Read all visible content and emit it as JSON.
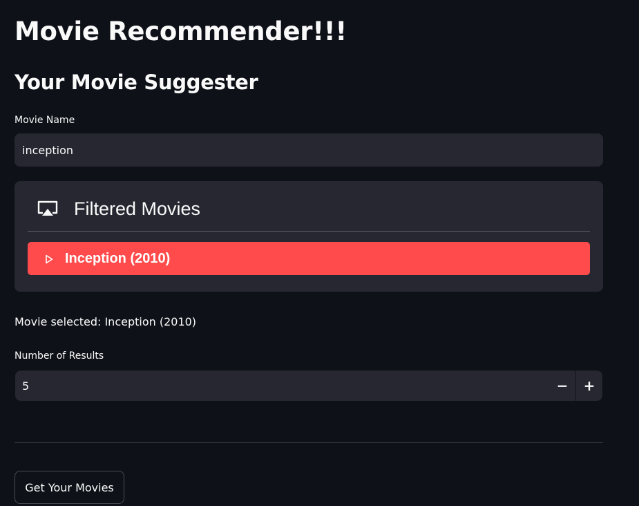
{
  "app": {
    "title": "Movie Recommender!!!",
    "subtitle": "Your Movie Suggester"
  },
  "movie_name": {
    "label": "Movie Name",
    "value": "inception"
  },
  "filtered": {
    "icon": "airplay-icon",
    "title": "Filtered Movies",
    "items": [
      {
        "label": "Inception (2010)",
        "icon": "play-triangle-icon"
      }
    ]
  },
  "selection": {
    "text": "Movie selected: Inception (2010)"
  },
  "results": {
    "label": "Number of Results",
    "value": "5",
    "minus": "−",
    "plus": "+"
  },
  "actions": {
    "get_movies": "Get Your Movies"
  },
  "colors": {
    "background": "#0e1117",
    "widget": "#262730",
    "accent": "#ff4b4b",
    "text": "#fafafa"
  }
}
